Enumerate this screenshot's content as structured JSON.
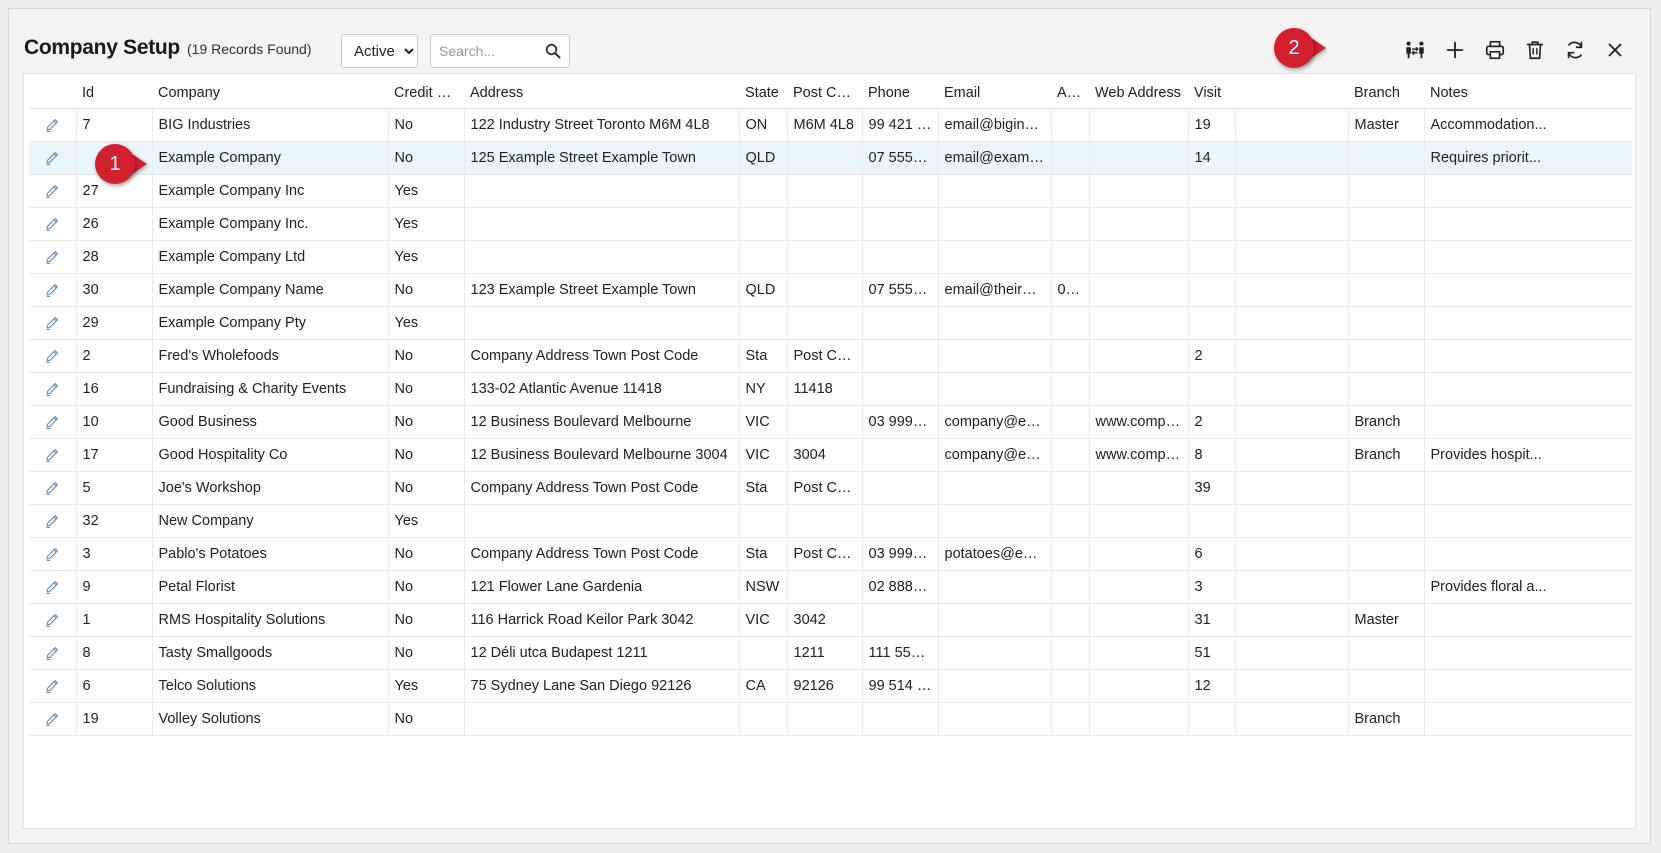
{
  "header": {
    "title": "Company Setup",
    "record_count": "(19 Records Found)",
    "status_options": [
      "Active"
    ],
    "status_selected": "Active",
    "search_placeholder": "Search..."
  },
  "toolbar": [
    {
      "name": "customize-columns-icon"
    },
    {
      "name": "add-icon"
    },
    {
      "name": "print-icon"
    },
    {
      "name": "delete-icon"
    },
    {
      "name": "refresh-icon"
    },
    {
      "name": "close-icon"
    }
  ],
  "callouts": [
    "1",
    "2"
  ],
  "accent_color": "#d2202f",
  "selected_row_color": "#e9f7fb",
  "columns": [
    "",
    "Id",
    "Company",
    "Credit H...",
    "Address",
    "State",
    "Post Cod...",
    "Phone",
    "Email",
    "AB...",
    "Web Address",
    "Visit",
    "",
    "Branch",
    "Notes"
  ],
  "rows": [
    [
      "7",
      "BIG Industries",
      "No",
      "122 Industry Street Toronto M6M 4L8",
      "ON",
      "M6M 4L8",
      "99 421 2...",
      "email@bigindu...",
      "",
      "",
      "19",
      "",
      "Master",
      "Accommodation..."
    ],
    [
      "",
      "Example Company",
      "No",
      "125 Example Street Example Town",
      "QLD",
      "",
      "07 5550 ...",
      "email@exampl...",
      "",
      "",
      "14",
      "",
      "",
      "Requires priorit..."
    ],
    [
      "27",
      "Example Company Inc",
      "Yes",
      "",
      "",
      "",
      "",
      "",
      "",
      "",
      "",
      "",
      "",
      ""
    ],
    [
      "26",
      "Example Company Inc.",
      "Yes",
      "",
      "",
      "",
      "",
      "",
      "",
      "",
      "",
      "",
      "",
      ""
    ],
    [
      "28",
      "Example Company Ltd",
      "Yes",
      "",
      "",
      "",
      "",
      "",
      "",
      "",
      "",
      "",
      "",
      ""
    ],
    [
      "30",
      "Example Company Name",
      "No",
      "123 Example Street Example Town",
      "QLD",
      "",
      "07 5550 ...",
      "email@theirdo...",
      "01...",
      "",
      "",
      "",
      "",
      ""
    ],
    [
      "29",
      "Example Company Pty",
      "Yes",
      "",
      "",
      "",
      "",
      "",
      "",
      "",
      "",
      "",
      "",
      ""
    ],
    [
      "2",
      "Fred's Wholefoods",
      "No",
      "Company Address Town Post Code",
      "Sta",
      "Post Code",
      "",
      "",
      "",
      "",
      "2",
      "",
      "",
      ""
    ],
    [
      "16",
      "Fundraising & Charity Events",
      "No",
      "133-02 Atlantic Avenue 11418",
      "NY",
      "11418",
      "",
      "",
      "",
      "",
      "",
      "",
      "",
      ""
    ],
    [
      "10",
      "Good Business",
      "No",
      "12 Business Boulevard Melbourne",
      "VIC",
      "",
      "03 9999 ...",
      "company@em...",
      "",
      "www.compa...",
      "2",
      "",
      "Branch",
      ""
    ],
    [
      "17",
      "Good Hospitality Co",
      "No",
      "12 Business Boulevard Melbourne 3004",
      "VIC",
      "3004",
      "",
      "company@em...",
      "",
      "www.compa...",
      "8",
      "",
      "Branch",
      "Provides hospit..."
    ],
    [
      "5",
      "Joe's Workshop",
      "No",
      "Company Address Town Post Code",
      "Sta",
      "Post Code",
      "",
      "",
      "",
      "",
      "39",
      "",
      "",
      ""
    ],
    [
      "32",
      "New Company",
      "Yes",
      "",
      "",
      "",
      "",
      "",
      "",
      "",
      "",
      "",
      "",
      ""
    ],
    [
      "3",
      "Pablo's Potatoes",
      "No",
      "Company Address Town Post Code",
      "Sta",
      "Post Code",
      "03 9999 ...",
      "potatoes@exa...",
      "",
      "",
      "6",
      "",
      "",
      ""
    ],
    [
      "9",
      "Petal Florist",
      "No",
      "121 Flower Lane Gardenia",
      "NSW",
      "",
      "02 8888 ...",
      "",
      "",
      "",
      "3",
      "",
      "",
      "Provides floral a..."
    ],
    [
      "1",
      "RMS Hospitality Solutions",
      "No",
      "116 Harrick Road Keilor Park 3042",
      "VIC",
      "3042",
      "",
      "",
      "",
      "",
      "31",
      "",
      "Master",
      ""
    ],
    [
      "8",
      "Tasty Smallgoods",
      "No",
      "12 Déli utca Budapest 1211",
      "",
      "1211",
      "111 555 ...",
      "",
      "",
      "",
      "51",
      "",
      "",
      ""
    ],
    [
      "6",
      "Telco Solutions",
      "Yes",
      "75 Sydney Lane San Diego 92126",
      "CA",
      "92126",
      "99 514 4...",
      "",
      "",
      "",
      "12",
      "",
      "",
      ""
    ],
    [
      "19",
      "Volley Solutions",
      "No",
      "",
      "",
      "",
      "",
      "",
      "",
      "",
      "",
      "",
      "Branch",
      ""
    ]
  ],
  "selected_row_index": 1
}
